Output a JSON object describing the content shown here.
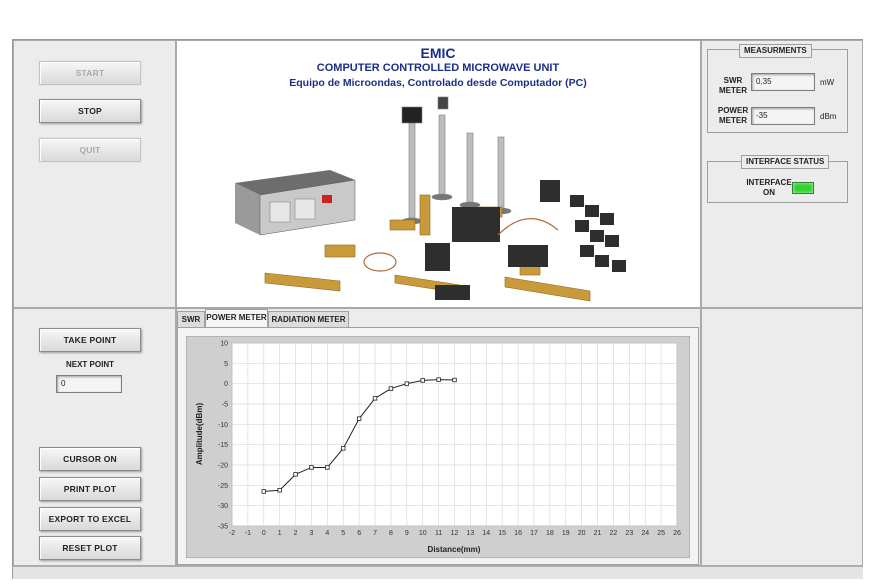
{
  "header": {
    "app_name": "EMIC",
    "title": "COMPUTER CONTROLLED MICROWAVE UNIT",
    "subtitle": "Equipo de Microondas, Controlado desde Computador (PC)"
  },
  "controls": {
    "start": "START",
    "stop": "STOP",
    "quit": "QUIT",
    "take_point": "TAKE POINT",
    "next_point_label": "NEXT POINT",
    "next_point_value": "0",
    "cursor_on": "CURSOR ON",
    "print_plot": "PRINT PLOT",
    "export_excel": "EXPORT TO EXCEL",
    "reset_plot": "RESET PLOT"
  },
  "measurements": {
    "title": "MEASURMENTS",
    "swr_label_1": "SWR",
    "swr_label_2": "METER",
    "swr_value": "0,35",
    "swr_unit": "mW",
    "power_label_1": "POWER",
    "power_label_2": "METER",
    "power_value": "-35",
    "power_unit": "dBm"
  },
  "interface": {
    "title": "INTERFACE STATUS",
    "label_1": "INTERFACE",
    "label_2": "ON",
    "led_color": "#2fd32f"
  },
  "tabs": [
    "SWR",
    "POWER METER",
    "RADIATION METER"
  ],
  "chart_data": {
    "type": "line",
    "xlabel": "Distance(mm)",
    "ylabel": "Amplitude(dBm)",
    "xlim": [
      -2,
      26
    ],
    "ylim": [
      -35,
      10
    ],
    "xticks": [
      -2,
      -1,
      0,
      1,
      2,
      3,
      4,
      5,
      6,
      7,
      8,
      9,
      10,
      11,
      12,
      13,
      14,
      15,
      16,
      17,
      18,
      19,
      20,
      21,
      22,
      23,
      24,
      25,
      26
    ],
    "yticks": [
      10,
      5,
      0,
      -5,
      -10,
      -15,
      -20,
      -25,
      -30,
      -35
    ],
    "grid": true,
    "x": [
      0,
      1,
      2,
      3,
      4,
      5,
      6,
      7,
      8,
      9,
      10,
      11,
      12
    ],
    "y": [
      -26.5,
      -26.2,
      -22.3,
      -20.6,
      -20.6,
      -15.9,
      -8.6,
      -3.6,
      -1.2,
      0.0,
      0.8,
      1.0,
      0.9
    ],
    "line_color": "#222222"
  }
}
